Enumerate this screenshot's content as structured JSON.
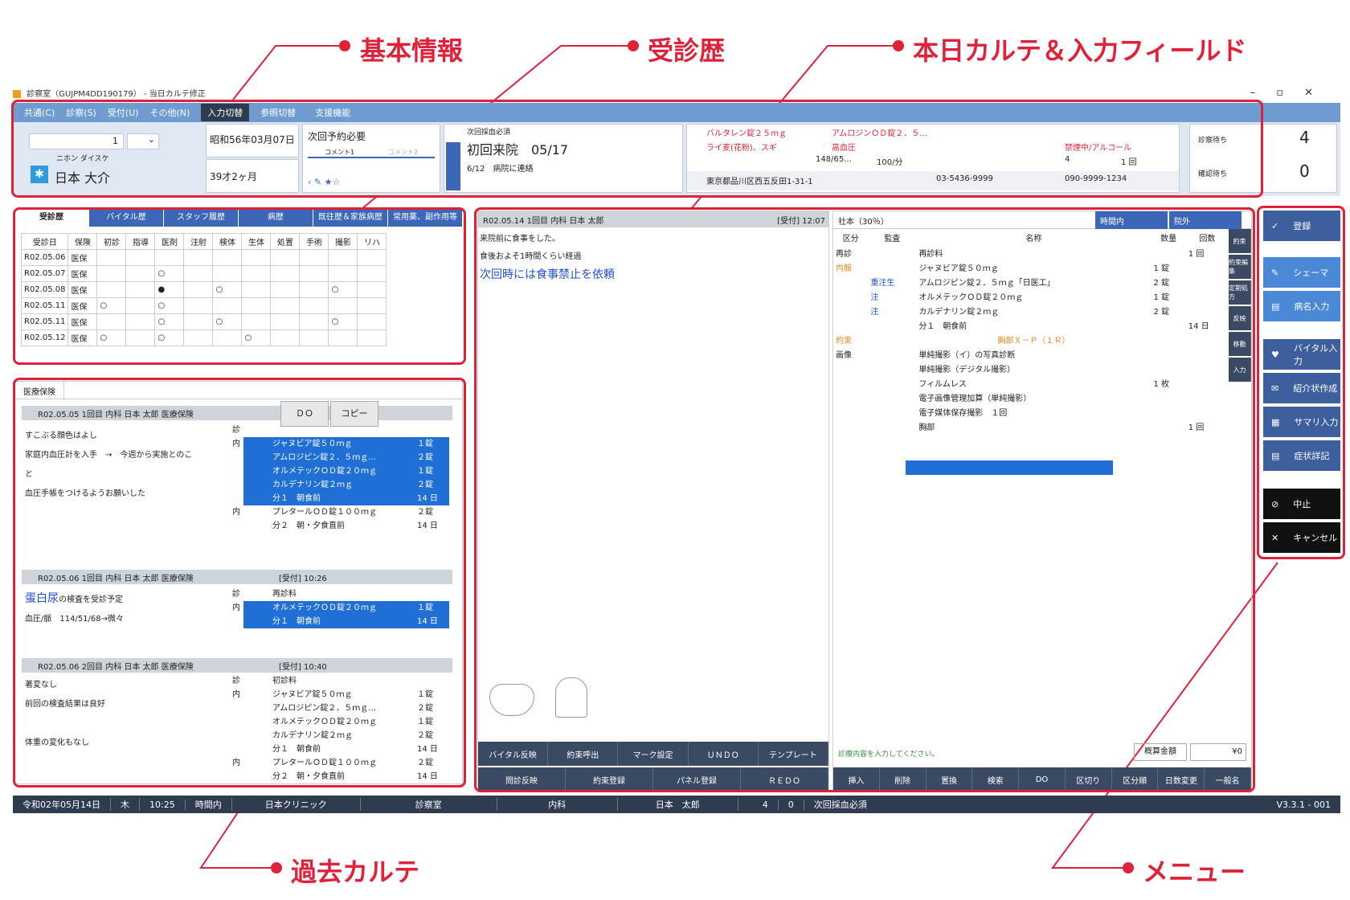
{
  "callouts": {
    "basic": "基本情報",
    "visit": "受診歴",
    "today": "本日カルテ＆入力フィールド",
    "past": "過去カルテ",
    "menu": "メニュー"
  },
  "window": {
    "title": "診察室（GUJPM4DD190179） - 当日カルテ修正"
  },
  "menubar": {
    "items": [
      "共通(C)",
      "診察(S)",
      "受付(U)",
      "その他(N)"
    ],
    "right": [
      "入力切替",
      "参照切替",
      "支援機能"
    ]
  },
  "patient": {
    "id": "1",
    "kana": "ニホン ダイスケ",
    "name": "日本 大介",
    "birth": "昭和56年03月07日",
    "age": "39才2ヶ月"
  },
  "reservation": {
    "label": "次回予約必要",
    "tab1": "コメント1",
    "tab2": "コメント2"
  },
  "visitinfo": {
    "note": "次回採血必須",
    "title": "初回来院　05/17",
    "sub": "6/12　病院に連絡"
  },
  "allergy": {
    "a1": "バルタレン錠２５ｍｇ",
    "a2": "アムロジンＯＤ錠２．５…",
    "a3": "ライ麦(花粉)、スギ",
    "a4": "高血圧",
    "a5": "禁煙中/アルコール",
    "bp": "148/65…",
    "pulse": "100/分",
    "n4": "4",
    "n1": "1 回",
    "address": "東京都品川区西五反田1-31-1",
    "tel": "03-5436-9999",
    "mobile": "090-9999-1234"
  },
  "waiting": {
    "l1": "診察待ち",
    "v1": "4",
    "l2": "確認待ち",
    "v2": "0"
  },
  "visitTabs": [
    "受診歴",
    "バイタル歴",
    "スタッフ履歴",
    "病歴",
    "既往歴＆家族病歴",
    "常用薬、副作用等"
  ],
  "visitHeaders": [
    "受診日",
    "保険",
    "初診",
    "指導",
    "医剤",
    "注射",
    "検体",
    "生体",
    "処置",
    "手術",
    "撮影",
    "リハ"
  ],
  "visitRows": [
    [
      "R02.05.06",
      "医保",
      "",
      "",
      "",
      "",
      "",
      "",
      "",
      "",
      "",
      ""
    ],
    [
      "R02.05.07",
      "医保",
      "",
      "",
      "○",
      "",
      "",
      "",
      "",
      "",
      "",
      ""
    ],
    [
      "R02.05.08",
      "医保",
      "",
      "",
      "●",
      "",
      "○",
      "",
      "",
      "",
      "○",
      ""
    ],
    [
      "R02.05.11",
      "医保",
      "○",
      "",
      "○",
      "",
      "",
      "",
      "",
      "",
      "",
      ""
    ],
    [
      "R02.05.11",
      "医保",
      "",
      "",
      "○",
      "",
      "○",
      "",
      "",
      "",
      "○",
      ""
    ],
    [
      "R02.05.12",
      "医保",
      "○",
      "",
      "○",
      "",
      "",
      "○",
      "",
      "",
      "",
      ""
    ]
  ],
  "past": {
    "tab": "医療保険",
    "do": "ＤＯ",
    "copy": "コピー",
    "e1h": "R02.05.05 1回目 内科 日本 太郎 医療保険",
    "e1l1": "すこぶる顔色はよし",
    "e1l2": "家庭内血圧計を入手　→　今週から実施とのこ",
    "e1l3": "と",
    "e1l4": "血圧手帳をつけるようお願いした",
    "e1rx": [
      [
        "診",
        "",
        ""
      ],
      [
        "内",
        "ジャヌビア錠５０ｍｇ",
        "１錠"
      ],
      [
        "",
        "アムロジピン錠２．５ｍｇ…",
        "２錠"
      ],
      [
        "",
        "オルメテックＯＤ錠２０ｍｇ",
        "１錠"
      ],
      [
        "",
        "カルデナリン錠２ｍｇ",
        "２錠"
      ],
      [
        "",
        "分１　朝食前",
        "14 日"
      ],
      [
        "内",
        "プレタールＯＤ錠１００ｍｇ",
        "２錠"
      ],
      [
        "",
        "分２　朝・夕食直前",
        "14 日"
      ]
    ],
    "e2h": "R02.05.06 1回目 内科 日本 太郎 医療保険",
    "e2t": "[受付] 10:26",
    "e2big": "蛋白尿",
    "e2l1": "の検査を受診予定",
    "e2l2": "血圧/脈　114/51/68→微々",
    "e2rx": [
      [
        "診",
        "再診料",
        ""
      ],
      [
        "内",
        "オルメテックＯＤ錠２０ｍｇ",
        "１錠"
      ],
      [
        "",
        "分１　朝食前",
        "14 日"
      ]
    ],
    "e3h": "R02.05.06 2回目 内科 日本 太郎 医療保険",
    "e3t": "[受付] 10:40",
    "e3l1": "著変なし",
    "e3l2": "前回の検査結果は良好",
    "e3l3": "体重の変化もなし",
    "e3rx": [
      [
        "診",
        "初診料",
        ""
      ],
      [
        "内",
        "ジャヌビア錠５０ｍｇ",
        "１錠"
      ],
      [
        "",
        "アムロジピン錠２．５ｍｇ…",
        "２錠"
      ],
      [
        "",
        "オルメテックＯＤ錠２０ｍｇ",
        "１錠"
      ],
      [
        "",
        "カルデナリン錠２ｍｇ",
        "２錠"
      ],
      [
        "",
        "分１　朝食前",
        "14 日"
      ],
      [
        "内",
        "プレタールＯＤ錠１００ｍｇ",
        "２錠"
      ],
      [
        "",
        "分２　朝・夕食直前",
        "14 日"
      ]
    ]
  },
  "today": {
    "header": "R02.05.14 1回目 内科 日本 太郎",
    "time": "[受付] 12:07",
    "l1": "来院前に食事をした。",
    "l2": "食後およそ1時間くらい経過",
    "l3": "次回時には食事禁止を依頼",
    "btns1": [
      "バイタル反映",
      "約束呼出",
      "マーク設定",
      "ＵＮＤＯ",
      "テンプレート"
    ],
    "btns2": [
      "問診反映",
      "約束登録",
      "パネル登録",
      "ＲＥＤＯ"
    ]
  },
  "orders": {
    "insurer": "社本（30％）",
    "sel1": "時間内",
    "sel2": "院外",
    "headers": [
      "区分",
      "監査",
      "名称",
      "数量",
      "回数"
    ],
    "rows": [
      [
        "再診",
        "",
        "再診料",
        "",
        "1 回"
      ],
      [
        "内服",
        "",
        "ジャヌビア錠５０ｍｇ",
        "1 錠",
        ""
      ],
      [
        "",
        "重注生",
        "アムロジピン錠２．５ｍｇ「日医工」",
        "2 錠",
        ""
      ],
      [
        "",
        "注",
        "オルメテックＯＤ錠２０ｍｇ",
        "1 錠",
        ""
      ],
      [
        "",
        "注",
        "カルデナリン錠２ｍｇ",
        "2 錠",
        ""
      ],
      [
        "",
        "",
        "分１　朝食前",
        "",
        "14 日"
      ],
      [
        "約束",
        "",
        "胸部Ｘ－Ｐ（１Ｒ）",
        "",
        ""
      ],
      [
        "画像",
        "",
        "単純撮影（イ）の写真診断",
        "",
        ""
      ],
      [
        "",
        "",
        "単純撮影（デジタル撮影）",
        "",
        ""
      ],
      [
        "",
        "",
        "フィルムレス",
        "1 枚",
        ""
      ],
      [
        "",
        "",
        "電子画像管理加算（単純撮影）",
        "",
        ""
      ],
      [
        "",
        "",
        "電子媒体保存撮影　１回",
        "",
        ""
      ],
      [
        "",
        "",
        "胸部",
        "",
        "1 回"
      ]
    ],
    "side": [
      "約束",
      "約束編集",
      "定期処方",
      "反映",
      "移動",
      "入力"
    ],
    "prompt": "診療内容を入力してください。",
    "calc": "概算金額",
    "yen": "¥0",
    "btns": [
      "挿入",
      "削除",
      "置換",
      "検索",
      "DO",
      "区切り",
      "区分順",
      "日数変更",
      "一般名"
    ]
  },
  "menu": {
    "items": [
      "登録",
      "シェーマ",
      "病名入力",
      "バイタル入力",
      "紹介状作成",
      "サマリ入力",
      "症状詳記",
      "中止",
      "キャンセル"
    ]
  },
  "status": {
    "date": "令和02年05月14日",
    "dow": "木",
    "time": "10:25",
    "shift": "時間内",
    "clinic": "日本クリニック",
    "room": "診察室",
    "dept": "内科",
    "doctor": "日本　太郎",
    "c1": "4",
    "c2": "0",
    "note": "次回採血必須",
    "ver": "V3.3.1 - 001"
  }
}
